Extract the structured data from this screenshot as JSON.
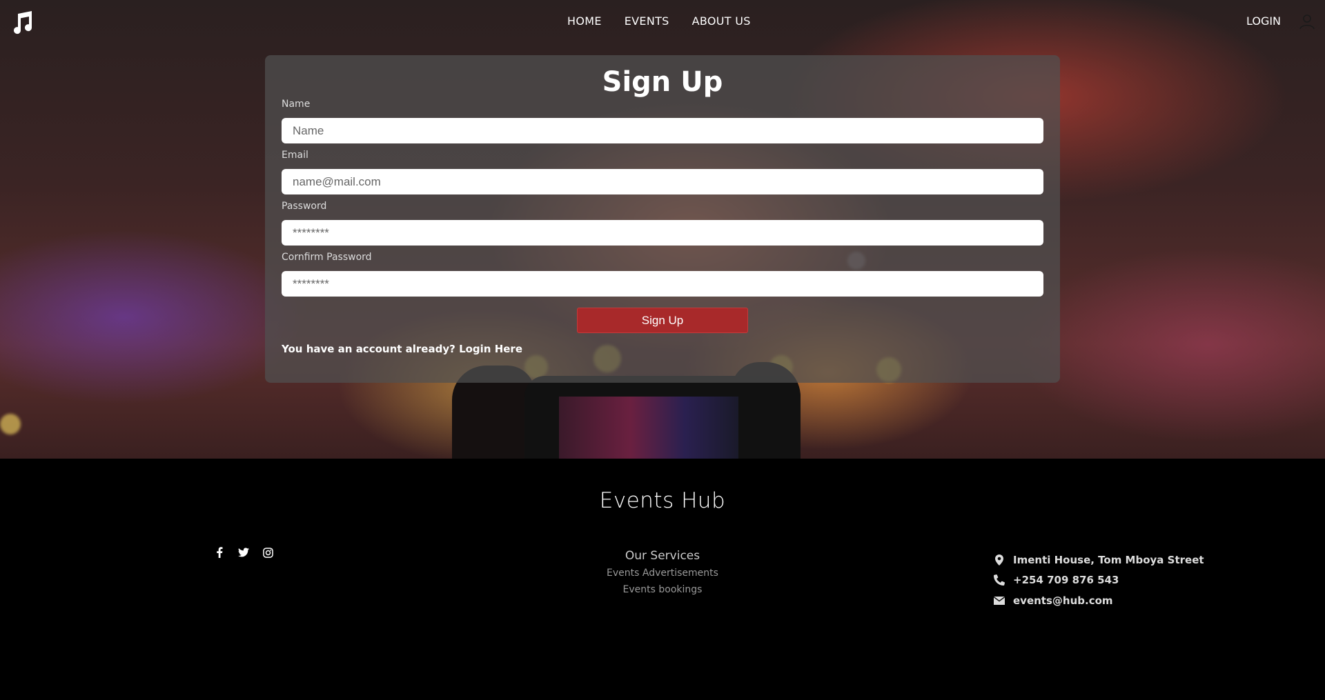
{
  "nav": {
    "logo_icon": "music-note-icon",
    "links": [
      "HOME",
      "EVENTS",
      "ABOUT US"
    ],
    "login": "LOGIN",
    "user_icon": "user-icon"
  },
  "form": {
    "title": "Sign Up",
    "name_label": "Name",
    "name_placeholder": "Name",
    "email_label": "Email",
    "email_placeholder": "name@mail.com",
    "password_label": "Password",
    "password_placeholder": "********",
    "confirm_label": "Cornfirm Password",
    "confirm_placeholder": "********",
    "submit_label": "Sign Up",
    "account_prompt": "You have an account already?",
    "login_link": "Login Here"
  },
  "footer": {
    "brand": "Events Hub",
    "social_icons": [
      "facebook-icon",
      "twitter-icon",
      "instagram-icon"
    ],
    "services_title": "Our Services",
    "services": [
      "Events Advertisements",
      "Events bookings"
    ],
    "address": "Imenti House, Tom Mboya Street",
    "phone": "+254 709 876 543",
    "email": "events@hub.com"
  },
  "colors": {
    "accent": "#a8292a",
    "footer_bg": "#000000",
    "card_bg": "#505050"
  }
}
